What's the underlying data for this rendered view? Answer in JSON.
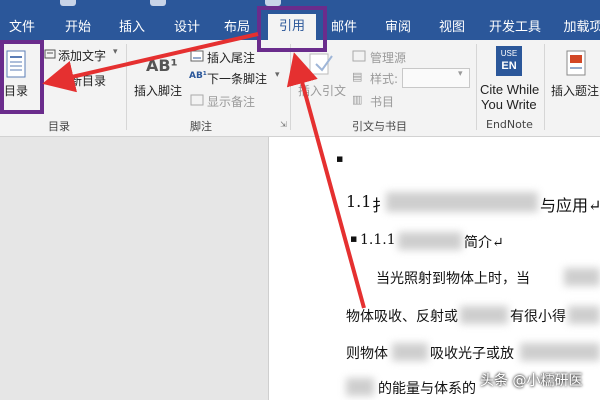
{
  "tabs": [
    "文件",
    "开始",
    "插入",
    "设计",
    "布局",
    "引用",
    "邮件",
    "审阅",
    "视图",
    "开发工具",
    "加载项"
  ],
  "active_tab": "引用",
  "ribbon": {
    "toc": {
      "button": "目录",
      "add_text": "添加文字",
      "update": "更新目录",
      "group": "目录"
    },
    "footnotes": {
      "insert_footnote_icon": "AB¹",
      "insert_footnote": "插入脚注",
      "insert_endnote": "插入尾注",
      "next_footnote": "下一条脚注",
      "show_notes": "显示备注",
      "group": "脚注"
    },
    "citations": {
      "insert_citation": "插入引文",
      "manage_sources": "管理源",
      "style_label": "样式:",
      "bibliography": "书目",
      "group": "引文与书目"
    },
    "endnote": {
      "logo_top": "USE",
      "logo_bottom": "EN",
      "line1": "Cite While",
      "line2": "You Write",
      "group": "EndNote"
    },
    "captions": {
      "insert_caption": "插入题注"
    }
  },
  "document": {
    "bullet1": "▪",
    "heading1_num": "1.1",
    "heading1_fragment": "扌",
    "heading1_tail": "与应用↵",
    "bullet2": "▪",
    "heading2_num": "1.1.1",
    "heading2_tail": "简介↵",
    "para_line1": "当光照射到物体上时，当",
    "para_line2_start": "物体吸收、反射或",
    "para_line2_mid": "有很小得",
    "para_line3_start": "则物体",
    "para_line3_mid": "吸收光子或放",
    "para_line4": "的能量与体系的"
  },
  "watermark": "头条 @小糯研医",
  "colors": {
    "ribbon_blue": "#2b579a",
    "highlight_purple": "#6a2c8c",
    "arrow_red": "#e53030"
  }
}
